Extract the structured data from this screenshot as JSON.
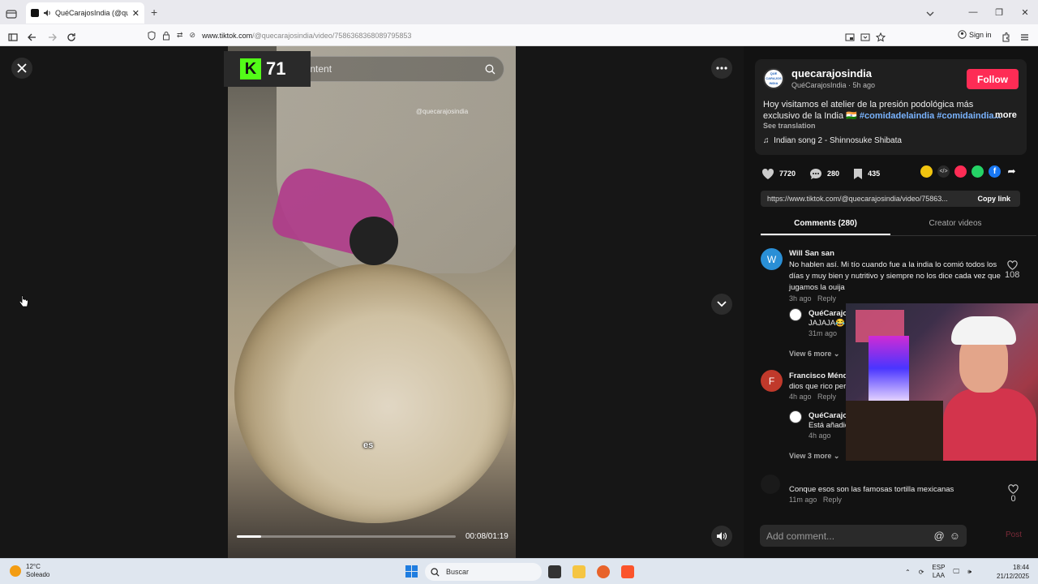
{
  "browser": {
    "tab_title": "QuéCarajosIndia (@quecarajosindia)",
    "url_host": "www.tiktok.com",
    "url_path": "/@quecarajosindia/video/7586368368089795853",
    "signin_label": "Sign in",
    "new_tab": "+"
  },
  "stream_overlay": {
    "score": "71",
    "logo": "K"
  },
  "video": {
    "search_placeholder": "Find related content",
    "watermark": "@quecarajosindia",
    "caption": "es",
    "current_time": "00:08",
    "duration": "01:19",
    "time_display": "00:08/01:19",
    "progress": 0.11
  },
  "post": {
    "username": "quecarajosindia",
    "display_name": "QuéCarajosIndia",
    "age": "5h ago",
    "subline": "QuéCarajosIndia · 5h ago",
    "avatar_text": "QUE CARAJOS INDIA",
    "follow_label": "Follow",
    "description_text": "Hoy visitamos el atelier de la presión podológica más exclusivo de la India 🇮🇳 ",
    "hashtag_1": "#comidadelaindia",
    "hashtag_2": "#comidaindia...",
    "more_label": "more",
    "see_translation": "See translation",
    "music": "Indian song 2 - Shinnosuke Shibata",
    "likes": "7720",
    "comments": "280",
    "saves": "435",
    "link": "https://www.tiktok.com/@quecarajosindia/video/75863...",
    "copy_link": "Copy link"
  },
  "tabs": [
    {
      "label": "Comments (280)",
      "active": true
    },
    {
      "label": "Creator videos",
      "active": false
    }
  ],
  "comments": [
    {
      "avatar_letter": "W",
      "avatar_color": "#2a8fd6",
      "name": "Will San san",
      "text": "No hablen así. Mi tío cuando fue a la india lo comió todos los días y muy bien y nutritivo y siempre no los dice cada vez que jugamos la ouija",
      "time": "3h ago",
      "reply": "Reply",
      "likes": "108",
      "replies": [
        {
          "name": "QuéCarajo",
          "text": "JAJAJA😂",
          "time": "31m ago"
        }
      ],
      "view_more": "View 6 more"
    },
    {
      "avatar_letter": "F",
      "avatar_color": "#c0392b",
      "name": "Francisco Ménde",
      "text": "dios que rico per",
      "time": "4h ago",
      "reply": "Reply",
      "replies": [
        {
          "name": "QuéCarajo",
          "text": "Está añadid",
          "time": "4h ago"
        }
      ],
      "view_more": "View 3 more"
    },
    {
      "avatar_letter": "",
      "avatar_color": "#1a1a1a",
      "name": "",
      "text": "Conque esos son las famosas tortilla mexicanas",
      "time": "11m ago",
      "reply": "Reply",
      "likes": "0"
    }
  ],
  "comment_input": {
    "placeholder": "Add comment...",
    "post_label": "Post"
  },
  "taskbar": {
    "temp": "12°C",
    "weather": "Soleado",
    "search_label": "Buscar",
    "lang": "ESP",
    "layout": "LAA",
    "time": "18:44",
    "date": "21/12/2025"
  },
  "colors": {
    "accent": "#fe2c55",
    "kick_green": "#53fc18",
    "link_blue": "#7ab4ff"
  }
}
